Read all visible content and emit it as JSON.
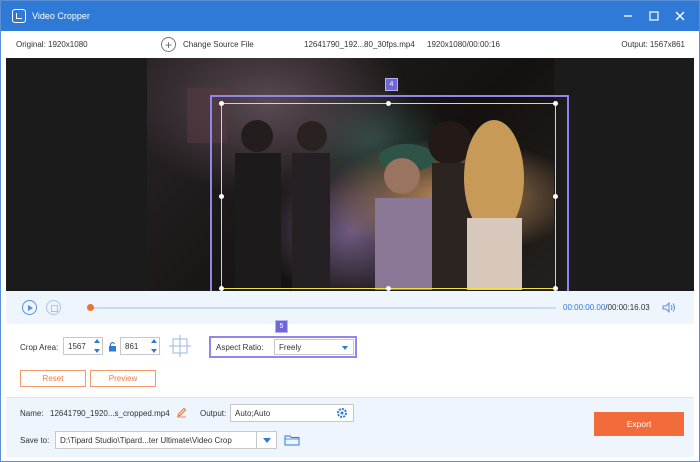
{
  "window": {
    "title": "Video Cropper",
    "minimize_icon": "minimize-icon",
    "maximize_icon": "maximize-icon",
    "close_icon": "close-icon"
  },
  "info": {
    "original": "Original: 1920x1080",
    "change_source": "Change Source File",
    "file_name": "12641790_192...80_30fps.mp4",
    "file_res": "1920x1080/00:00:16",
    "output": "Output: 1567x861"
  },
  "badges": {
    "crop_box": "4",
    "aspect": "5"
  },
  "playback": {
    "current": "00:00:00.00",
    "total": "/00:00:16.03",
    "progress": 0.0
  },
  "crop": {
    "label": "Crop Area:",
    "width": "1567",
    "height": "861",
    "aspect_label": "Aspect Ratio:",
    "aspect_value": "Freely",
    "reset": "Reset",
    "preview": "Preview"
  },
  "output_settings": {
    "name_label": "Name:",
    "name_value": "12641790_1920...s_cropped.mp4",
    "output_label": "Output:",
    "output_value": "Auto;Auto",
    "save_label": "Save to:",
    "save_value": "D:\\Tipard Studio\\Tipard...ter Ultimate\\Video Crop",
    "export": "Export"
  },
  "colors": {
    "titlebar": "#2f7ad6",
    "accent_orange": "#f26b3a",
    "highlight": "#8f88ea"
  }
}
